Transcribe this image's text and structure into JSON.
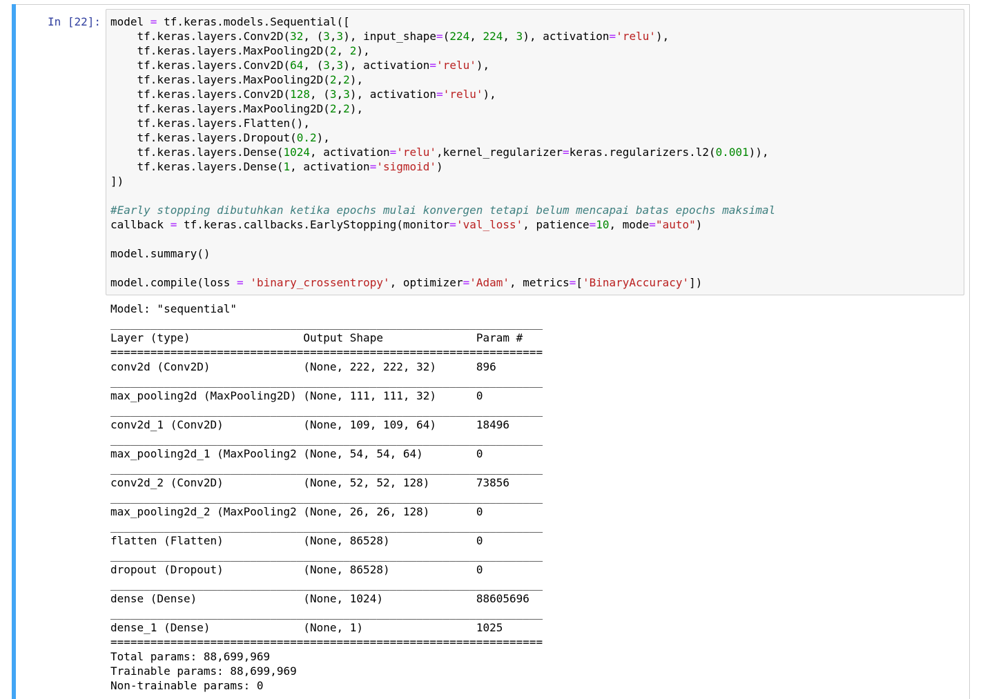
{
  "prompt": "In [22]:",
  "code": {
    "model_line": [
      "model ",
      "=",
      " tf.keras.models.Sequential([",
      ""
    ],
    "layers": [
      {
        "parts": [
          [
            "t",
            "    tf.keras.layers.Conv2D("
          ],
          [
            "n",
            "32"
          ],
          [
            "t",
            ", ("
          ],
          [
            "n",
            "3"
          ],
          [
            "t",
            ","
          ],
          [
            "n",
            "3"
          ],
          [
            "t",
            "), input_shape"
          ],
          [
            "o",
            "="
          ],
          [
            "t",
            "("
          ],
          [
            "n",
            "224"
          ],
          [
            "t",
            ", "
          ],
          [
            "n",
            "224"
          ],
          [
            "t",
            ", "
          ],
          [
            "n",
            "3"
          ],
          [
            "t",
            "), activation"
          ],
          [
            "o",
            "="
          ],
          [
            "s",
            "'relu'"
          ],
          [
            "t",
            "),"
          ]
        ]
      },
      {
        "parts": [
          [
            "t",
            "    tf.keras.layers.MaxPooling2D("
          ],
          [
            "n",
            "2"
          ],
          [
            "t",
            ", "
          ],
          [
            "n",
            "2"
          ],
          [
            "t",
            "),"
          ]
        ]
      },
      {
        "parts": [
          [
            "t",
            "    tf.keras.layers.Conv2D("
          ],
          [
            "n",
            "64"
          ],
          [
            "t",
            ", ("
          ],
          [
            "n",
            "3"
          ],
          [
            "t",
            ","
          ],
          [
            "n",
            "3"
          ],
          [
            "t",
            "), activation"
          ],
          [
            "o",
            "="
          ],
          [
            "s",
            "'relu'"
          ],
          [
            "t",
            "),"
          ]
        ]
      },
      {
        "parts": [
          [
            "t",
            "    tf.keras.layers.MaxPooling2D("
          ],
          [
            "n",
            "2"
          ],
          [
            "t",
            ","
          ],
          [
            "n",
            "2"
          ],
          [
            "t",
            "),"
          ]
        ]
      },
      {
        "parts": [
          [
            "t",
            "    tf.keras.layers.Conv2D("
          ],
          [
            "n",
            "128"
          ],
          [
            "t",
            ", ("
          ],
          [
            "n",
            "3"
          ],
          [
            "t",
            ","
          ],
          [
            "n",
            "3"
          ],
          [
            "t",
            "), activation"
          ],
          [
            "o",
            "="
          ],
          [
            "s",
            "'relu'"
          ],
          [
            "t",
            "),"
          ]
        ]
      },
      {
        "parts": [
          [
            "t",
            "    tf.keras.layers.MaxPooling2D("
          ],
          [
            "n",
            "2"
          ],
          [
            "t",
            ","
          ],
          [
            "n",
            "2"
          ],
          [
            "t",
            "),"
          ]
        ]
      },
      {
        "parts": [
          [
            "t",
            "    tf.keras.layers.Flatten(),"
          ]
        ]
      },
      {
        "parts": [
          [
            "t",
            "    tf.keras.layers.Dropout("
          ],
          [
            "n",
            "0.2"
          ],
          [
            "t",
            "),"
          ]
        ]
      },
      {
        "parts": [
          [
            "t",
            "    tf.keras.layers.Dense("
          ],
          [
            "n",
            "1024"
          ],
          [
            "t",
            ", activation"
          ],
          [
            "o",
            "="
          ],
          [
            "s",
            "'relu'"
          ],
          [
            "t",
            ",kernel_regularizer"
          ],
          [
            "o",
            "="
          ],
          [
            "t",
            "keras.regularizers.l2("
          ],
          [
            "n",
            "0.001"
          ],
          [
            "t",
            ")),"
          ]
        ]
      },
      {
        "parts": [
          [
            "t",
            "    tf.keras.layers.Dense("
          ],
          [
            "n",
            "1"
          ],
          [
            "t",
            ", activation"
          ],
          [
            "o",
            "="
          ],
          [
            "s",
            "'sigmoid'"
          ],
          [
            "t",
            ")"
          ]
        ]
      }
    ],
    "close": "])",
    "comment": "#Early stopping dibutuhkan ketika epochs mulai konvergen tetapi belum mencapai batas epochs maksimal",
    "callback_parts": [
      [
        "t",
        "callback "
      ],
      [
        "o",
        "="
      ],
      [
        "t",
        " tf.keras.callbacks.EarlyStopping(monitor"
      ],
      [
        "o",
        "="
      ],
      [
        "s",
        "'val_loss'"
      ],
      [
        "t",
        ", patience"
      ],
      [
        "o",
        "="
      ],
      [
        "n",
        "10"
      ],
      [
        "t",
        ", mode"
      ],
      [
        "o",
        "="
      ],
      [
        "s",
        "\"auto\""
      ],
      [
        "t",
        ")"
      ]
    ],
    "summary_line": "model.summary()",
    "compile_parts": [
      [
        "t",
        "model.compile(loss "
      ],
      [
        "o",
        "="
      ],
      [
        "t",
        " "
      ],
      [
        "s",
        "'binary_crossentropy'"
      ],
      [
        "t",
        ", optimizer"
      ],
      [
        "o",
        "="
      ],
      [
        "s",
        "'Adam'"
      ],
      [
        "t",
        ", metrics"
      ],
      [
        "o",
        "="
      ],
      [
        "t",
        "["
      ],
      [
        "s",
        "'BinaryAccuracy'"
      ],
      [
        "t",
        "])"
      ]
    ]
  },
  "output": {
    "model_title": "Model: \"sequential\"",
    "rule_single": "_________________________________________________________________",
    "rule_double": "=================================================================",
    "headers": {
      "layer": "Layer (type)",
      "shape": "Output Shape",
      "params": "Param #"
    },
    "rows": [
      {
        "layer": "conv2d (Conv2D)",
        "shape": "(None, 222, 222, 32)",
        "params": "896"
      },
      {
        "layer": "max_pooling2d (MaxPooling2D)",
        "shape": "(None, 111, 111, 32)",
        "params": "0"
      },
      {
        "layer": "conv2d_1 (Conv2D)",
        "shape": "(None, 109, 109, 64)",
        "params": "18496"
      },
      {
        "layer": "max_pooling2d_1 (MaxPooling2",
        "shape": "(None, 54, 54, 64)",
        "params": "0"
      },
      {
        "layer": "conv2d_2 (Conv2D)",
        "shape": "(None, 52, 52, 128)",
        "params": "73856"
      },
      {
        "layer": "max_pooling2d_2 (MaxPooling2",
        "shape": "(None, 26, 26, 128)",
        "params": "0"
      },
      {
        "layer": "flatten (Flatten)",
        "shape": "(None, 86528)",
        "params": "0"
      },
      {
        "layer": "dropout (Dropout)",
        "shape": "(None, 86528)",
        "params": "0"
      },
      {
        "layer": "dense (Dense)",
        "shape": "(None, 1024)",
        "params": "88605696"
      },
      {
        "layer": "dense_1 (Dense)",
        "shape": "(None, 1)",
        "params": "1025"
      }
    ],
    "total": "Total params: 88,699,969",
    "trainable": "Trainable params: 88,699,969",
    "non_trainable": "Non-trainable params: 0"
  },
  "colors": {
    "cell_bar": "#42a5f5",
    "prompt": "#303f9f",
    "number": "#008800",
    "string": "#ba2121",
    "operator": "#aa22ff",
    "comment": "#408080"
  }
}
